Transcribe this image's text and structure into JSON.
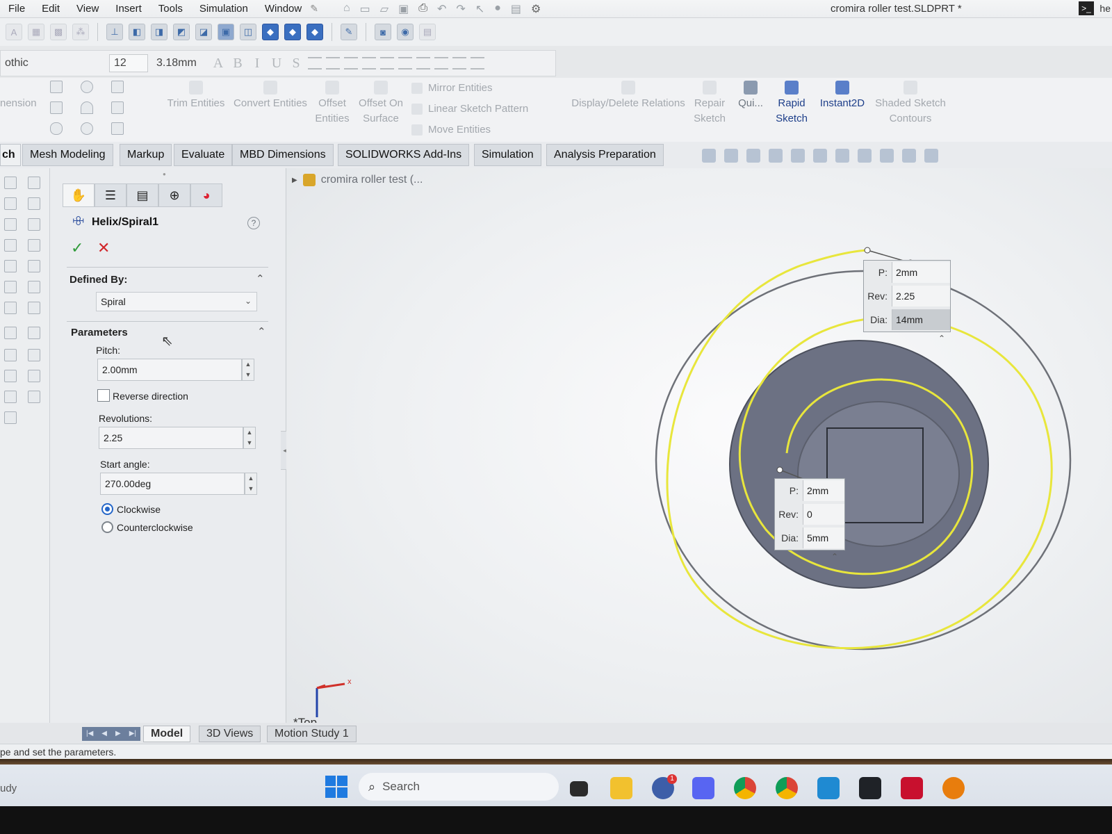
{
  "menubar": {
    "items": [
      "File",
      "Edit",
      "View",
      "Insert",
      "Tools",
      "Simulation",
      "Window"
    ],
    "document_title": "cromira roller test.SLDPRT *",
    "corner_text": "he"
  },
  "formatbar": {
    "font_name": "othic",
    "font_size": "12",
    "height_value": "3.18mm",
    "styles": [
      "A",
      "B",
      "I",
      "U",
      "S"
    ]
  },
  "command_manager": {
    "dimension_label": "nension",
    "trim_entities": "Trim Entities",
    "convert_entities": "Convert Entities",
    "offset_entities_1": "Offset",
    "offset_entities_2": "Entities",
    "offset_on_surface_1": "Offset On",
    "offset_on_surface_2": "Surface",
    "mirror_entities": "Mirror Entities",
    "linear_sketch_pattern": "Linear Sketch Pattern",
    "move_entities": "Move Entities",
    "display_delete_relations": "Display/Delete Relations",
    "repair_sketch_1": "Repair",
    "repair_sketch_2": "Sketch",
    "quick_snaps": "Qui...",
    "rapid_sketch_1": "Rapid",
    "rapid_sketch_2": "Sketch",
    "instant2d": "Instant2D",
    "shaded_sketch_1": "Shaded Sketch",
    "shaded_sketch_2": "Contours"
  },
  "tabs": {
    "sketch_partial": "ch",
    "items": [
      "Mesh Modeling",
      "Markup",
      "Evaluate",
      "MBD Dimensions",
      "SOLIDWORKS Add-Ins",
      "Simulation",
      "Analysis Preparation"
    ]
  },
  "property_manager": {
    "title": "Helix/Spiral1",
    "defined_by": {
      "header": "Defined By:",
      "value": "Spiral"
    },
    "parameters": {
      "header": "Parameters",
      "pitch_label": "Pitch:",
      "pitch_value": "2.00mm",
      "reverse_direction_label": "Reverse direction",
      "reverse_direction_checked": false,
      "revolutions_label": "Revolutions:",
      "revolutions_value": "2.25",
      "start_angle_label": "Start angle:",
      "start_angle_value": "270.00deg",
      "clockwise_label": "Clockwise",
      "counterclockwise_label": "Counterclockwise",
      "direction_selected": "Clockwise"
    }
  },
  "graphics": {
    "tree_flyout_label": "cromira roller test (...",
    "view_orientation_label": "*Top",
    "triad_x_label": "x",
    "callout_outer": {
      "p_key": "P:",
      "p_value": "2mm",
      "rev_key": "Rev:",
      "rev_value": "2.25",
      "dia_key": "Dia:",
      "dia_value": "14mm"
    },
    "callout_inner": {
      "p_key": "P:",
      "p_value": "2mm",
      "rev_key": "Rev:",
      "rev_value": "0",
      "dia_key": "Dia:",
      "dia_value": "5mm"
    },
    "colors": {
      "spiral": "#e6e63a",
      "disc": "#6e7385",
      "background": "#f2f3f5"
    }
  },
  "bottom_tabs": {
    "items": [
      "Model",
      "3D Views",
      "Motion Study 1"
    ],
    "active": "Model"
  },
  "status_bar": {
    "message": "pe and set the parameters."
  },
  "taskbar": {
    "left_text": "udy",
    "search_label": "Search",
    "notification_badge": "1"
  }
}
